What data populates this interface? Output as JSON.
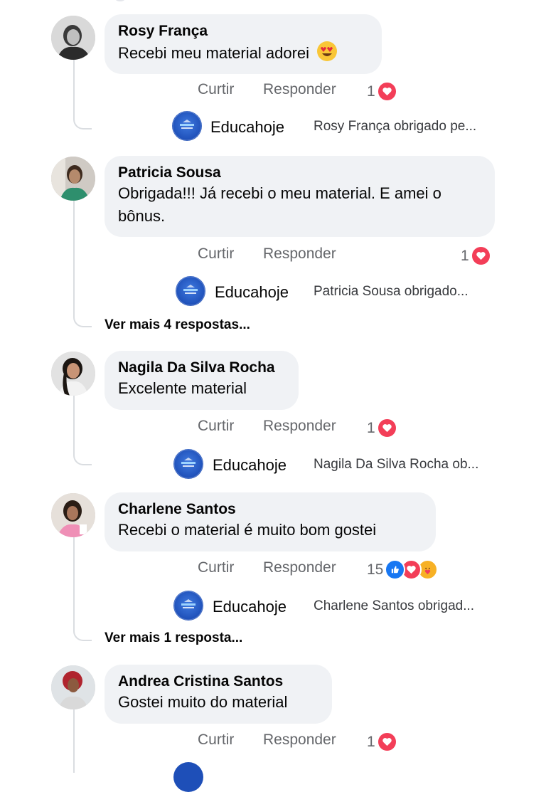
{
  "actions": {
    "like_label": "Curtir",
    "reply_label": "Responder"
  },
  "comments": [
    {
      "author": "Rosy França",
      "text": "Recebi meu material adorei",
      "reaction_count": "1",
      "reply": {
        "name": "Educahoje",
        "text": "Rosy França obrigado pe..."
      }
    },
    {
      "author": "Patricia Sousa",
      "text": "Obrigada!!! Já recebi o meu material. E amei o bônus.",
      "reaction_count": "1",
      "reply": {
        "name": "Educahoje",
        "text": "Patricia Sousa obrigado..."
      },
      "more": "Ver mais 4 respostas..."
    },
    {
      "author": "Nagila Da Silva Rocha",
      "text": "Excelente material",
      "reaction_count": "1",
      "reply": {
        "name": "Educahoje",
        "text": "Nagila Da Silva Rocha ob..."
      }
    },
    {
      "author": "Charlene Santos",
      "text": "Recebi o material é muito bom gostei",
      "reaction_count": "15",
      "reply": {
        "name": "Educahoje",
        "text": "Charlene Santos  obrigad..."
      },
      "more": "Ver mais 1 resposta..."
    },
    {
      "author": "Andrea Cristina Santos",
      "text": "Gostei muito do material",
      "reaction_count": "1"
    }
  ],
  "colors": {
    "love": "#f33e58",
    "like": "#1877f2",
    "care": "#f7b125",
    "bubble": "#f0f2f5",
    "meta": "#65676b"
  },
  "icons": {
    "love": "heart-icon",
    "like": "thumbs-up-icon",
    "care": "care-hug-icon",
    "emoji": "heart-eyes-emoji-icon"
  }
}
